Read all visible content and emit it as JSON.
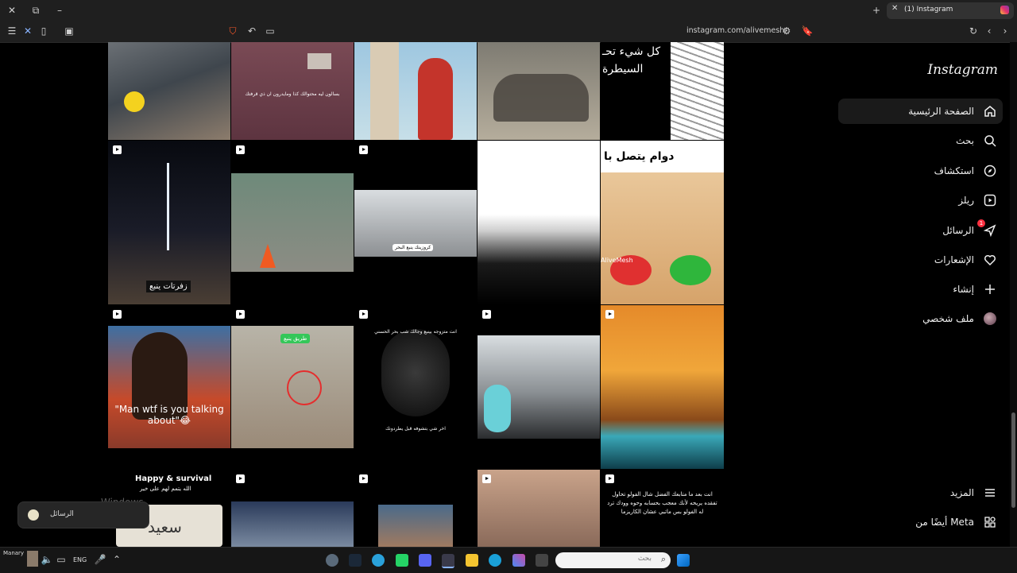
{
  "browser": {
    "tab_title": "(1) Instagram",
    "url": "instagram.com/alivemesh/"
  },
  "grid": {
    "captions": {
      "t1": "بسالون ليه محتوالك كذا ومايدرون ان ذي قرفتك",
      "t4": "كل شيء تحـ",
      "t4b": "السيطرة",
      "t9": "زفرتات ينبع",
      "t11": "كروزينك ينبع البحر",
      "t14": "دوام يتصل با",
      "t14b": "AliveMesh",
      "t15": "\"Man wtf is you talking about\"😂",
      "t16": "طريق ينبع",
      "t17": "انت متزوجه بينبع وجالك شب بحر الحسني",
      "t17b": "اخر شي بتشوفه قبل يطردونك",
      "t20": "Happy & survival",
      "t20b": "الله يتمم لهم على خير",
      "t20c": "سعيد",
      "t24": "انت بعد ما متابعك الفضل شال الفولو تحاول تفقده يريحه لأنك معجب بحسابه وحوه وودك ترد له الفولو بس ماتبي عشان الكاريزما"
    }
  },
  "sidebar": {
    "logo": "Instagram",
    "items": [
      {
        "label": "الصفحة الرئيسية",
        "icon": "home-icon"
      },
      {
        "label": "بحث",
        "icon": "search-icon"
      },
      {
        "label": "استكشاف",
        "icon": "compass-icon"
      },
      {
        "label": "ريلز",
        "icon": "reels-icon"
      },
      {
        "label": "الرسائل",
        "icon": "messenger-icon",
        "badge": "1"
      },
      {
        "label": "الإشعارات",
        "icon": "heart-icon"
      },
      {
        "label": "إنشاء",
        "icon": "plus-icon"
      },
      {
        "label": "ملف شخصي",
        "icon": "avatar"
      }
    ],
    "more": "المزيد",
    "meta": "أيضًا من Meta"
  },
  "toast": {
    "text": "الرسائل"
  },
  "watermark": "Windows",
  "taskbar": {
    "weather": "Manary",
    "lang": "ENG",
    "search_placeholder": "بحث"
  },
  "colors": {
    "accent_red": "#ff3040"
  }
}
